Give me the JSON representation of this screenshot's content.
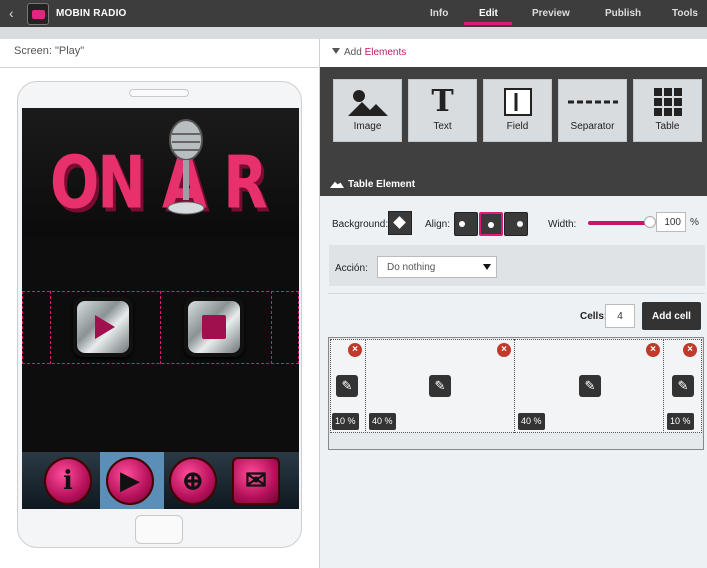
{
  "app": {
    "title": "MOBIN RADIO",
    "back_glyph": "‹",
    "tabs": [
      {
        "label": "Info"
      },
      {
        "label": "Edit"
      },
      {
        "label": "Preview"
      },
      {
        "label": "Publish"
      },
      {
        "label": "Tools"
      }
    ],
    "active_tab": "Edit"
  },
  "left": {
    "screen_label": "Screen: \"Play\"",
    "banner_text": "ON A R"
  },
  "right": {
    "add_prefix": "Add",
    "add_highlight": "Elements",
    "palette": [
      {
        "label": "Image",
        "icon": "image-icon"
      },
      {
        "label": "Text",
        "icon": "text-icon"
      },
      {
        "label": "Field",
        "icon": "field-icon"
      },
      {
        "label": "Separator",
        "icon": "separator-icon"
      },
      {
        "label": "Table",
        "icon": "table-icon"
      }
    ],
    "section_title": "Table Element",
    "background_label": "Background:",
    "align_label": "Align:",
    "width_label": "Width:",
    "width_value": "100",
    "width_unit": "%",
    "width_fraction": 1.0,
    "accion_label": "Acción:",
    "accion_value": "Do nothing",
    "cells_label": "Cells:",
    "cells_value": "4",
    "add_cell_label": "Add cell",
    "cells": [
      {
        "pct": "10 %"
      },
      {
        "pct": "40 %"
      },
      {
        "pct": "40 %"
      },
      {
        "pct": "10 %"
      }
    ]
  },
  "colors": {
    "accent": "#e0187b",
    "topbar": "#3d3d3d",
    "panel_dark": "#404040"
  }
}
